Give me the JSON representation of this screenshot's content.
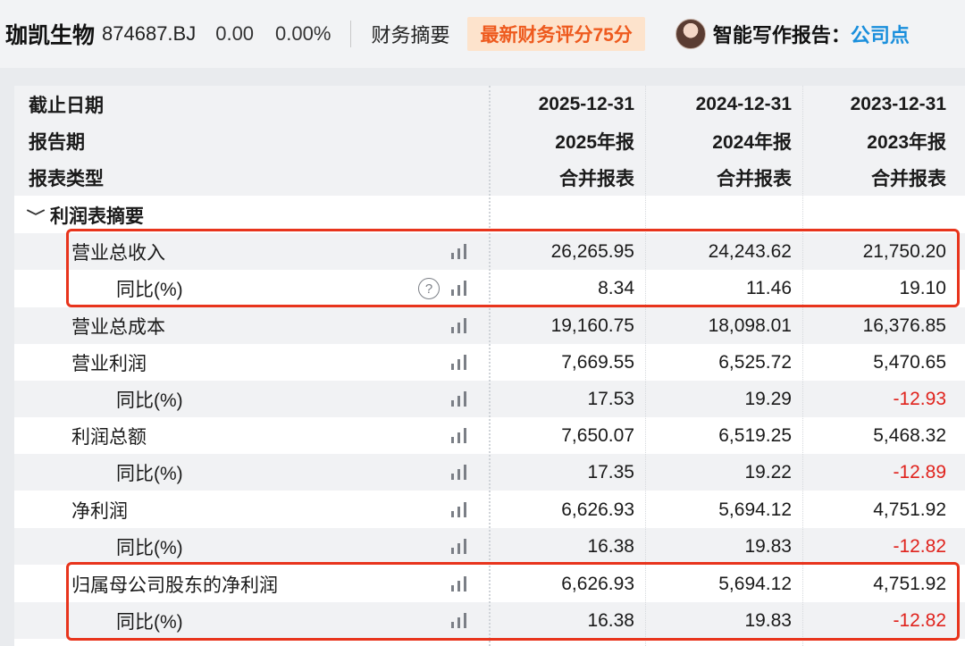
{
  "header": {
    "stock_name": "珈凯生物",
    "stock_code": "874687.BJ",
    "price": "0.00",
    "change_pct": "0.00%",
    "tab_summary": "财务摘要",
    "score_badge": "最新财务评分75分",
    "ai_label": "智能写作报告：",
    "ai_link": "公司点"
  },
  "table": {
    "headers": [
      {
        "label": "截止日期",
        "values": [
          "2025-12-31",
          "2024-12-31",
          "2023-12-31"
        ]
      },
      {
        "label": "报告期",
        "values": [
          "2025年报",
          "2024年报",
          "2023年报"
        ]
      },
      {
        "label": "报表类型",
        "values": [
          "合并报表",
          "合并报表",
          "合并报表"
        ]
      }
    ],
    "section": "利润表摘要",
    "rows": [
      {
        "label": "营业总收入",
        "values": [
          "26,265.95",
          "24,243.62",
          "21,750.20"
        ]
      },
      {
        "label": "同比(%)",
        "values": [
          "8.34",
          "11.46",
          "19.10"
        ]
      },
      {
        "label": "营业总成本",
        "values": [
          "19,160.75",
          "18,098.01",
          "16,376.85"
        ]
      },
      {
        "label": "营业利润",
        "values": [
          "7,669.55",
          "6,525.72",
          "5,470.65"
        ]
      },
      {
        "label": "同比(%)",
        "values": [
          "17.53",
          "19.29",
          "-12.93"
        ]
      },
      {
        "label": "利润总额",
        "values": [
          "7,650.07",
          "6,519.25",
          "5,468.32"
        ]
      },
      {
        "label": "同比(%)",
        "values": [
          "17.35",
          "19.22",
          "-12.89"
        ]
      },
      {
        "label": "净利润",
        "values": [
          "6,626.93",
          "5,694.12",
          "4,751.92"
        ]
      },
      {
        "label": "同比(%)",
        "values": [
          "16.38",
          "19.83",
          "-12.82"
        ]
      },
      {
        "label": "归属母公司股东的净利润",
        "values": [
          "6,626.93",
          "5,694.12",
          "4,751.92"
        ]
      },
      {
        "label": "同比(%)",
        "values": [
          "16.38",
          "19.83",
          "-12.82"
        ]
      }
    ],
    "help_symbol": "?",
    "negative_color": "#e0231d",
    "highlight_color": "#e8341c"
  },
  "icons": {
    "chart": "bar-chart-icon",
    "help": "help-circle-icon",
    "collapse": "chevron-down-icon"
  }
}
